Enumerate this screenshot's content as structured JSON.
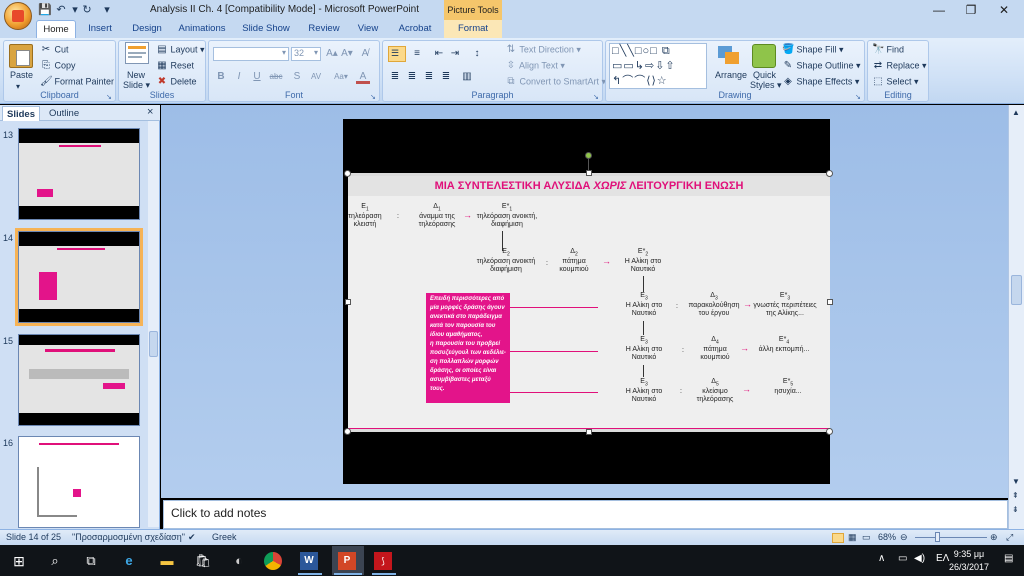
{
  "window": {
    "title": "Analysis II Ch. 4 [Compatibility Mode] - Microsoft PowerPoint",
    "contextual_tab_title": "Picture Tools",
    "controls": {
      "minimize": "—",
      "restore": "❐",
      "close": "✕"
    }
  },
  "qat": {
    "save": "💾",
    "undo": "↶",
    "redo": "↻",
    "more": "▾"
  },
  "tabs": [
    {
      "label": "Home",
      "active": true
    },
    {
      "label": "Insert"
    },
    {
      "label": "Design"
    },
    {
      "label": "Animations"
    },
    {
      "label": "Slide Show"
    },
    {
      "label": "Review"
    },
    {
      "label": "View"
    },
    {
      "label": "Acrobat"
    },
    {
      "label": "Format"
    }
  ],
  "ribbon": {
    "clipboard": {
      "label": "Clipboard",
      "paste": "Paste",
      "cut": "Cut",
      "copy": "Copy",
      "format_painter": "Format Painter"
    },
    "slides": {
      "label": "Slides",
      "new_slide_line1": "New",
      "new_slide_line2": "Slide ▾",
      "layout": "Layout ▾",
      "reset": "Reset",
      "delete": "Delete"
    },
    "font": {
      "label": "Font",
      "font_name": "",
      "font_size": "32",
      "grow": "A▴",
      "shrink": "A▾",
      "clear": "A̸",
      "bold": "B",
      "italic": "I",
      "underline": "U",
      "strike": "abc",
      "shadow": "S",
      "spacing": "AV",
      "case": "Aa▾",
      "color": "A"
    },
    "paragraph": {
      "label": "Paragraph",
      "text_direction": "Text Direction ▾",
      "align_text": "Align Text ▾",
      "convert_smartart": "Convert to SmartArt ▾"
    },
    "drawing": {
      "label": "Drawing",
      "arrange": "Arrange",
      "quick_styles_line1": "Quick",
      "quick_styles_line2": "Styles ▾",
      "shape_fill": "Shape Fill ▾",
      "shape_outline": "Shape Outline ▾",
      "shape_effects": "Shape Effects ▾"
    },
    "editing": {
      "label": "Editing",
      "find": "Find",
      "replace": "Replace ▾",
      "select": "Select ▾"
    }
  },
  "left_panel": {
    "tabs": [
      {
        "label": "Slides",
        "active": true
      },
      {
        "label": "Outline"
      }
    ],
    "close": "×",
    "thumbnails": [
      {
        "number": "13"
      },
      {
        "number": "14",
        "selected": true
      },
      {
        "number": "15"
      },
      {
        "number": "16"
      }
    ]
  },
  "slide": {
    "title_normal": "ΜΙΑ ΣΥΝΤΕΛΕΣΤΙΚΗ ΑΛΥΣΙΔΑ ",
    "title_italic": "ΧΩΡΙΣ",
    "title_end": " ΛΕΙΤΟΥΡΓΙΚΗ ΕΝΩΣΗ",
    "row1": {
      "e1": "Ε",
      "e1_sub": "1",
      "e1_text1": "τηλεόραση",
      "e1_text2": "κλειστή",
      "colon": ":",
      "d1": "Δ",
      "d1_sub": "1",
      "d1_text1": "άναμμα της",
      "d1_text2": "τηλεόρασης",
      "arrow": "→",
      "e2": "Ε*",
      "e2_sub": "1",
      "e2_text1": "τηλεόραση ανοικτή,",
      "e2_text2": "διαφήμιση"
    },
    "row2": {
      "e": "Ε",
      "e_sub": "2",
      "e_text1": "τηλεόραση ανοικτή",
      "e_text2": "διαφήμιση",
      "colon": ":",
      "d": "Δ",
      "d_sub": "2",
      "d_text1": "πάτημα",
      "d_text2": "κουμπιού",
      "arrow": "→",
      "e2": "Ε*",
      "e2_sub": "2",
      "e2_text1": "Η Αλίκη στο",
      "e2_text2": "Ναυτικό"
    },
    "row3": {
      "e": "Ε",
      "e_sub": "3",
      "e_text1": "Η Αλίκη στο",
      "e_text2": "Ναυτικό",
      "colon": ":",
      "d": "Δ",
      "d_sub": "3",
      "d_text1": "παρακολούθηση",
      "d_text2": "του έργου",
      "arrow": "→",
      "e2": "Ε*",
      "e2_sub": "3",
      "e2_text1": "γνωστές περιπέτειες",
      "e2_text2": "της Αλίκης..."
    },
    "row4": {
      "e": "Ε",
      "e_sub": "3",
      "e_text1": "Η Αλίκη στο",
      "e_text2": "Ναυτικό",
      "colon": ":",
      "d": "Δ",
      "d_sub": "4",
      "d_text1": "πάτημα",
      "d_text2": "κουμπιού",
      "arrow": "→",
      "e2": "Ε*",
      "e2_sub": "4",
      "e2_text1": "άλλη εκπομπή..."
    },
    "row5": {
      "e": "Ε",
      "e_sub": "3",
      "e_text1": "Η Αλίκη στο",
      "e_text2": "Ναυτικό",
      "colon": ":",
      "d": "Δ",
      "d_sub": "5",
      "d_text1": "κλείσιμο",
      "d_text2": "τηλεόρασης",
      "arrow": "→",
      "e2": "Ε*",
      "e2_sub": "5",
      "e2_text1": "ησυχία..."
    },
    "pinkbox_lines": [
      "Επειδή περισσότερες από",
      "μία μορφές δράσης άγουν",
      "ανεκτικά στο παράδειγμα",
      "κατά τον παρουσία του",
      "ίδιου αμαθήματος,",
      "η παρουσία του προβρεί",
      "ποσυζεύγουλ των αεδέλιε-",
      "ση πολλαπλών μορφών",
      "δράσης, οι οποίες είναι",
      "ασυμβίβαστες μεταξύ",
      "τους."
    ]
  },
  "notes": {
    "placeholder": "Click to add notes"
  },
  "statusbar": {
    "slide_info": "Slide 14 of 25",
    "theme": "\"Προσαρμοσμένη σχεδίαση\"",
    "language": "Greek",
    "zoom": "68%"
  },
  "taskbar": {
    "tray_lang": "ΕΛ",
    "time": "9:35 μμ",
    "date": "26/3/2017"
  },
  "colors": {
    "accent_pink": "#e0107a",
    "ribbon_blue": "#c5d9f1",
    "context_tab": "#f5c66b"
  }
}
